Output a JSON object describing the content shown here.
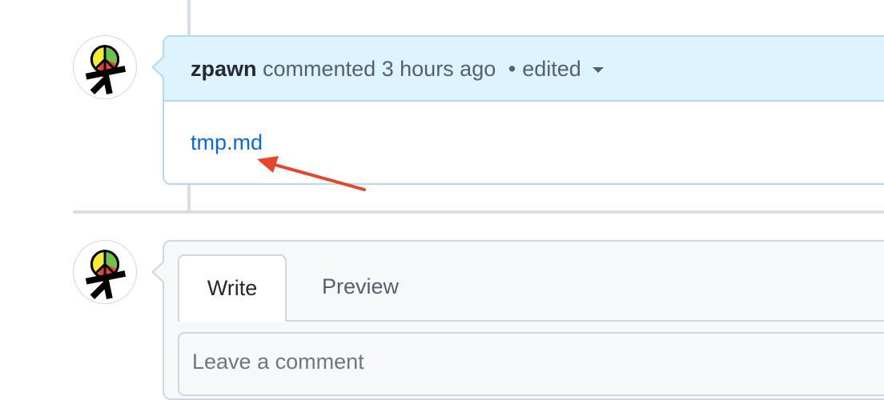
{
  "comment": {
    "author": "zpawn",
    "action": "commented",
    "time": "3 hours ago",
    "separator": "•",
    "edited": "edited",
    "attachment": "tmp.md"
  },
  "editor": {
    "tabs": [
      "Write",
      "Preview"
    ],
    "active_tab": "Write",
    "placeholder": "Leave a comment"
  },
  "colors": {
    "link": "#0969da",
    "header_bg": "#ddf4ff",
    "annotation_arrow": "#e8442b"
  },
  "icons": {
    "avatar": "user-avatar-icon",
    "dropdown": "chevron-down-icon",
    "annotation": "red-arrow-icon"
  }
}
